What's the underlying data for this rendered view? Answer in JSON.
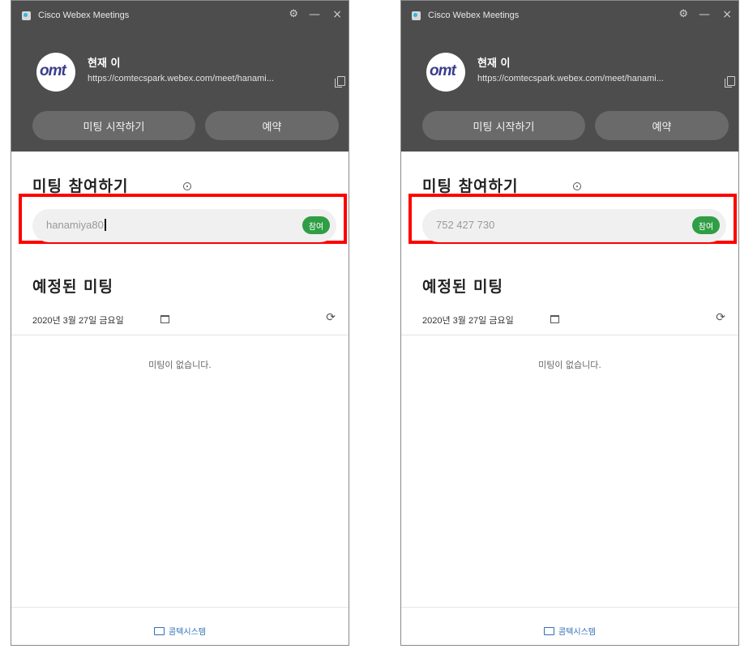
{
  "windows": [
    {
      "titlebar": {
        "app_title": "Cisco Webex Meetings",
        "settings_icon": "gear-icon",
        "minimize_glyph": "—",
        "close_glyph": "×"
      },
      "profile": {
        "avatar_text": "omt",
        "name": "현재 이",
        "url": "https://comtecspark.webex.com/meet/hanami..."
      },
      "actions": {
        "start_label": "미팅 시작하기",
        "schedule_label": "예약"
      },
      "join": {
        "title": "미팅 참여하기",
        "value": "hanamiya80",
        "placeholder": "",
        "button_label": "참여",
        "focused": true
      },
      "scheduled": {
        "title": "예정된 미팅",
        "date": "2020년 3월 27일 금요일",
        "empty_message": "미팅이 없습니다."
      },
      "footer": {
        "link_label": "콤텍시스템"
      }
    },
    {
      "titlebar": {
        "app_title": "Cisco Webex Meetings",
        "settings_icon": "gear-icon",
        "minimize_glyph": "—",
        "close_glyph": "×"
      },
      "profile": {
        "avatar_text": "omt",
        "name": "현재 이",
        "url": "https://comtecspark.webex.com/meet/hanami..."
      },
      "actions": {
        "start_label": "미팅 시작하기",
        "schedule_label": "예약"
      },
      "join": {
        "title": "미팅 참여하기",
        "value": "752 427 730",
        "placeholder": "",
        "button_label": "참여",
        "focused": false
      },
      "scheduled": {
        "title": "예정된 미팅",
        "date": "2020년 3월 27일 금요일",
        "empty_message": "미팅이 없습니다."
      },
      "footer": {
        "link_label": "콤텍시스템"
      }
    }
  ],
  "colors": {
    "header_bg": "#4d4d4d",
    "highlight": "#ff0000",
    "join_button": "#2f9e44",
    "link": "#2e6fb7"
  }
}
